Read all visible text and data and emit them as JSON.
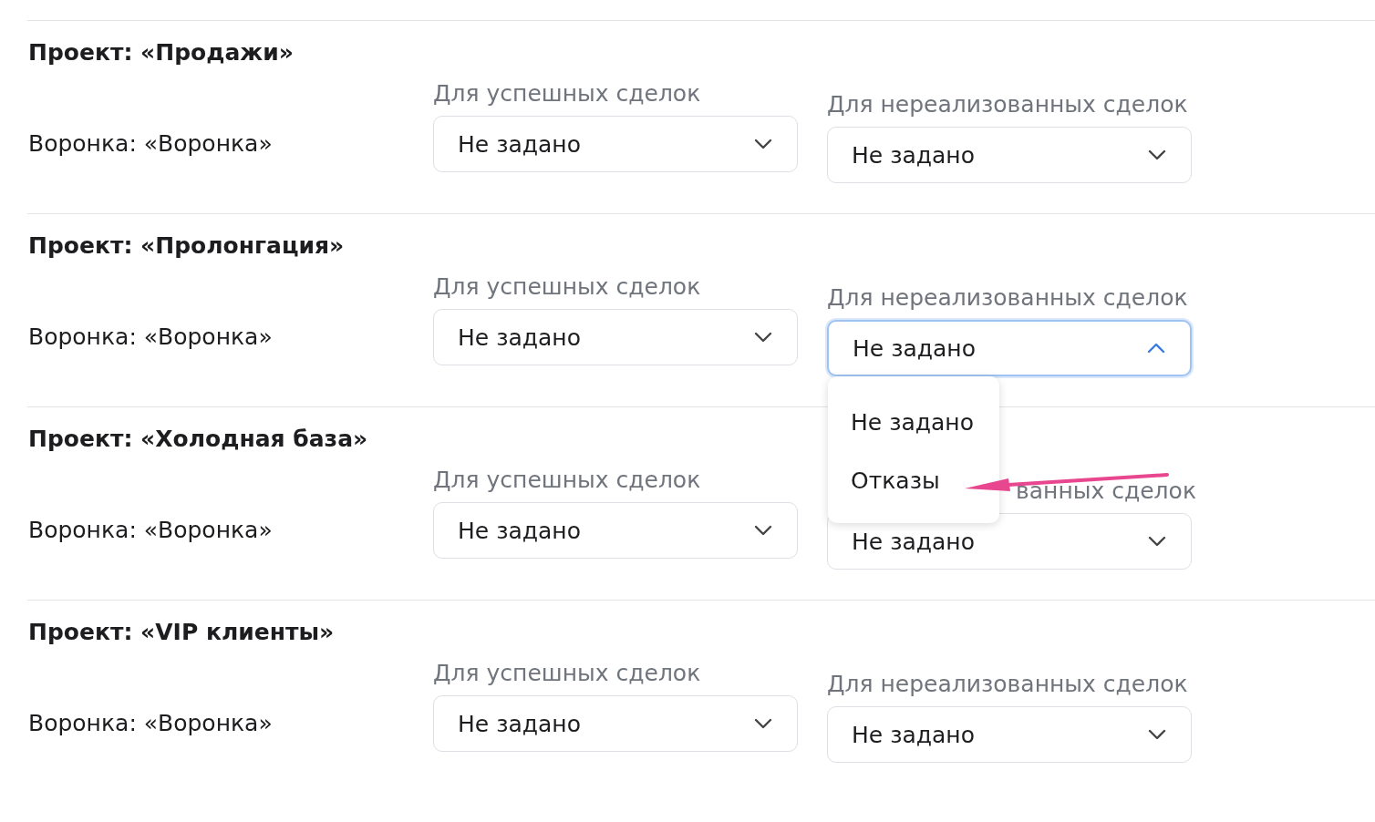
{
  "projects": [
    {
      "title": "Проект: «Продажи»",
      "funnel": "Воронка: «Воронка»",
      "selects": [
        {
          "label": "Для успешных сделок",
          "value": "Не задано",
          "open": false,
          "label_covered": false
        },
        {
          "label": "Для нереализованных сделок",
          "value": "Не задано",
          "open": false,
          "label_covered": false
        }
      ]
    },
    {
      "title": "Проект: «Пролонгация»",
      "funnel": "Воронка: «Воронка»",
      "selects": [
        {
          "label": "Для успешных сделок",
          "value": "Не задано",
          "open": false,
          "label_covered": false
        },
        {
          "label": "Для нереализованных сделок",
          "value": "Не задано",
          "open": true,
          "label_covered": false,
          "options": [
            "Не задано",
            "Отказы"
          ]
        }
      ]
    },
    {
      "title": "Проект: «Холодная база»",
      "funnel": "Воронка: «Воронка»",
      "selects": [
        {
          "label": "Для успешных сделок",
          "value": "Не задано",
          "open": false,
          "label_covered": false
        },
        {
          "label": "ванных сделок",
          "value": "Не задано",
          "open": false,
          "label_covered": true
        }
      ]
    },
    {
      "title": "Проект: «VIP клиенты»",
      "funnel": "Воронка: «Воронка»",
      "selects": [
        {
          "label": "Для успешных сделок",
          "value": "Не задано",
          "open": false,
          "label_covered": false
        },
        {
          "label": "Для нереализованных сделок",
          "value": "Не задано",
          "open": false,
          "label_covered": false
        }
      ]
    }
  ]
}
